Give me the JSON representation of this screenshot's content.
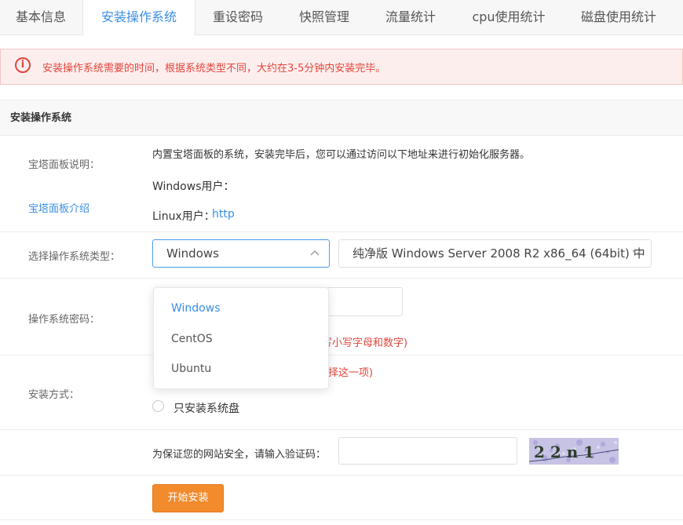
{
  "tabs": [
    "基本信息",
    "安装操作系统",
    "重设密码",
    "快照管理",
    "流量统计",
    "cpu使用统计",
    "磁盘使用统计"
  ],
  "active_tab": "安装操作系统",
  "alert": {
    "icon": "info-icon",
    "text": "安装操作系统需要的时间，根据系统类型不同，大约在3-5分钟内安装完毕。"
  },
  "section_title": "安装操作系统",
  "panel": {
    "label": "宝塔面板说明：",
    "intro_link": "宝塔面板介绍",
    "description": "内置宝塔面板的系统，安装完毕后，您可以通过访问以下地址来进行初始化服务器。",
    "windows_user": "Windows用户：",
    "linux_user": "Linux用户：",
    "linux_url": "http"
  },
  "os_select": {
    "label": "选择操作系统类型：",
    "value": "Windows",
    "version_value": "纯净版 Windows Server 2008 R2 x86_64 (64bit) 中",
    "options": [
      "Windows",
      "CentOS",
      "Ubuntu"
    ]
  },
  "password": {
    "label": "操作系统密码：",
    "hint_visible": "写小写字母和数字)"
  },
  "install_mode": {
    "label": "安装方式：",
    "hint_visible": "择这一项)",
    "option_label": "只安装系统盘"
  },
  "captcha": {
    "prompt": "为保证您的网站安全，请输入验证码：",
    "code": "2 2 n 1"
  },
  "submit_label": "开始安装",
  "colors": {
    "accent": "#3a8ee6",
    "alert_text": "#e4453a",
    "alert_bg": "#fdeeee",
    "button": "#f28b2c"
  }
}
